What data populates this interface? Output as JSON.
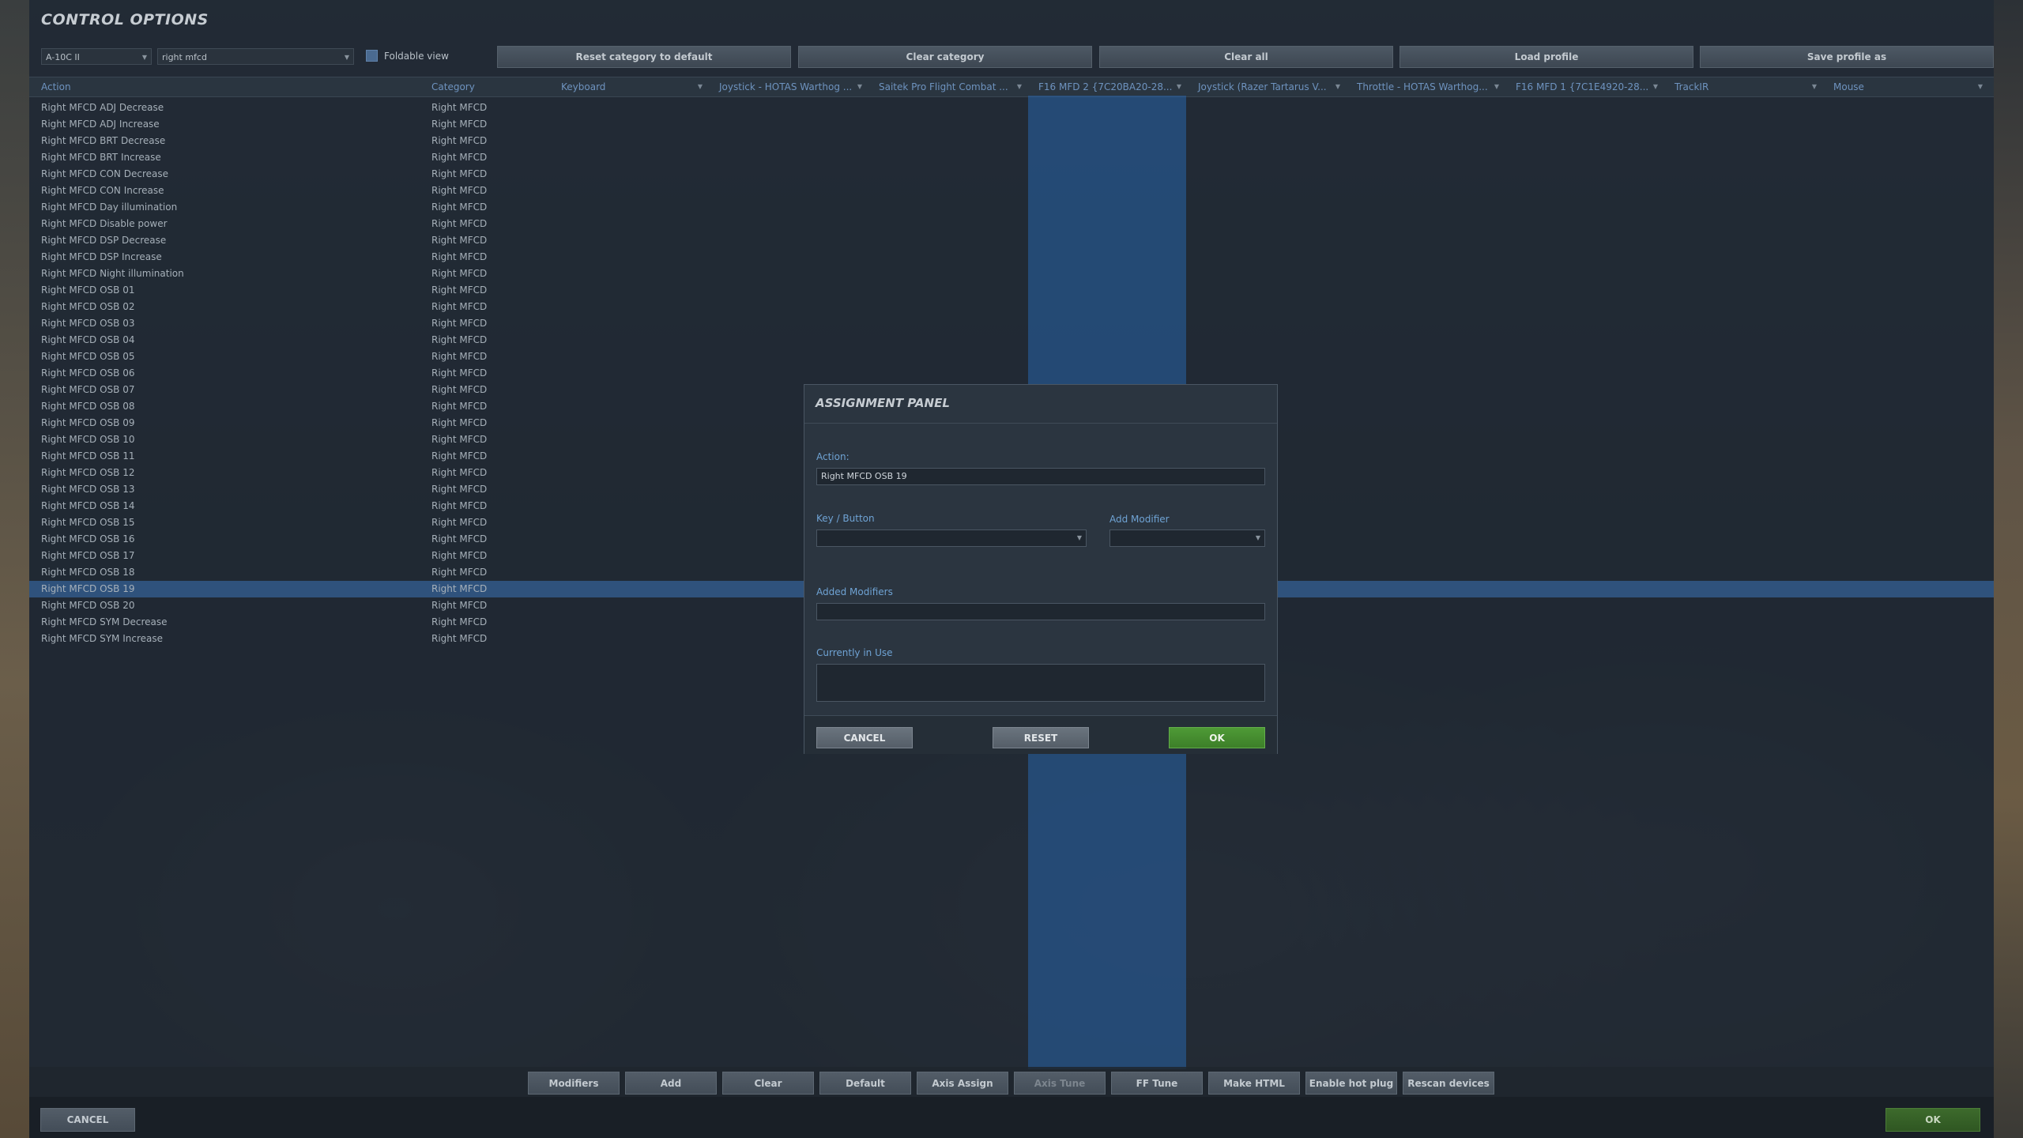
{
  "window": {
    "title": "CONTROL OPTIONS"
  },
  "toolbar": {
    "aircraft_select": "A-10C II",
    "search_value": "right mfcd",
    "foldable_view_label": "Foldable view",
    "foldable_view_checked": true,
    "buttons": [
      "Reset category to default",
      "Clear category",
      "Clear all",
      "Load profile",
      "Save profile as"
    ]
  },
  "table": {
    "columns": [
      "Action",
      "Category",
      "Keyboard",
      "Joystick - HOTAS Warthog ...",
      "Saitek Pro Flight Combat ...",
      "F16 MFD 2 {7C20BA20-28...",
      "Joystick (Razer Tartarus V...",
      "Throttle - HOTAS Warthog...",
      "F16 MFD 1 {7C1E4920-28...",
      "TrackIR",
      "Mouse"
    ],
    "highlighted_column": "F16 MFD 2 {7C20BA20-28...",
    "selected_row": "Right MFCD OSB 19",
    "rows": [
      {
        "action": "Right MFCD ADJ Decrease",
        "category": "Right MFCD"
      },
      {
        "action": "Right MFCD ADJ Increase",
        "category": "Right MFCD"
      },
      {
        "action": "Right MFCD BRT Decrease",
        "category": "Right MFCD"
      },
      {
        "action": "Right MFCD BRT Increase",
        "category": "Right MFCD"
      },
      {
        "action": "Right MFCD CON Decrease",
        "category": "Right MFCD"
      },
      {
        "action": "Right MFCD CON Increase",
        "category": "Right MFCD"
      },
      {
        "action": "Right MFCD Day illumination",
        "category": "Right MFCD"
      },
      {
        "action": "Right MFCD Disable power",
        "category": "Right MFCD"
      },
      {
        "action": "Right MFCD DSP Decrease",
        "category": "Right MFCD"
      },
      {
        "action": "Right MFCD DSP Increase",
        "category": "Right MFCD"
      },
      {
        "action": "Right MFCD Night illumination",
        "category": "Right MFCD"
      },
      {
        "action": "Right MFCD OSB 01",
        "category": "Right MFCD"
      },
      {
        "action": "Right MFCD OSB 02",
        "category": "Right MFCD"
      },
      {
        "action": "Right MFCD OSB 03",
        "category": "Right MFCD"
      },
      {
        "action": "Right MFCD OSB 04",
        "category": "Right MFCD"
      },
      {
        "action": "Right MFCD OSB 05",
        "category": "Right MFCD"
      },
      {
        "action": "Right MFCD OSB 06",
        "category": "Right MFCD"
      },
      {
        "action": "Right MFCD OSB 07",
        "category": "Right MFCD"
      },
      {
        "action": "Right MFCD OSB 08",
        "category": "Right MFCD"
      },
      {
        "action": "Right MFCD OSB 09",
        "category": "Right MFCD"
      },
      {
        "action": "Right MFCD OSB 10",
        "category": "Right MFCD"
      },
      {
        "action": "Right MFCD OSB 11",
        "category": "Right MFCD"
      },
      {
        "action": "Right MFCD OSB 12",
        "category": "Right MFCD"
      },
      {
        "action": "Right MFCD OSB 13",
        "category": "Right MFCD"
      },
      {
        "action": "Right MFCD OSB 14",
        "category": "Right MFCD"
      },
      {
        "action": "Right MFCD OSB 15",
        "category": "Right MFCD"
      },
      {
        "action": "Right MFCD OSB 16",
        "category": "Right MFCD"
      },
      {
        "action": "Right MFCD OSB 17",
        "category": "Right MFCD"
      },
      {
        "action": "Right MFCD OSB 18",
        "category": "Right MFCD"
      },
      {
        "action": "Right MFCD OSB 19",
        "category": "Right MFCD"
      },
      {
        "action": "Right MFCD OSB 20",
        "category": "Right MFCD"
      },
      {
        "action": "Right MFCD SYM Decrease",
        "category": "Right MFCD"
      },
      {
        "action": "Right MFCD SYM Increase",
        "category": "Right MFCD"
      }
    ]
  },
  "assignment_panel": {
    "title": "ASSIGNMENT PANEL",
    "action_label": "Action:",
    "action_value": "Right MFCD OSB 19",
    "key_button_label": "Key / Button",
    "key_button_value": "",
    "add_modifier_label": "Add Modifier",
    "add_modifier_value": "",
    "added_modifiers_label": "Added Modifiers",
    "added_modifiers_value": "",
    "currently_in_use_label": "Currently in Use",
    "currently_in_use_value": "",
    "cancel_label": "CANCEL",
    "reset_label": "RESET",
    "ok_label": "OK"
  },
  "bottom_toolbar": {
    "buttons": [
      "Modifiers",
      "Add",
      "Clear",
      "Default",
      "Axis Assign",
      "Axis Tune",
      "FF Tune",
      "Make HTML",
      "Enable hot plug",
      "Rescan devices"
    ],
    "disabled": [
      "Axis Tune"
    ]
  },
  "footer": {
    "cancel_label": "CANCEL",
    "ok_label": "OK"
  },
  "colors": {
    "accent_blue": "#6fa3d4",
    "highlight_column": "#2864aa",
    "ok_green": "#4e9a36"
  }
}
